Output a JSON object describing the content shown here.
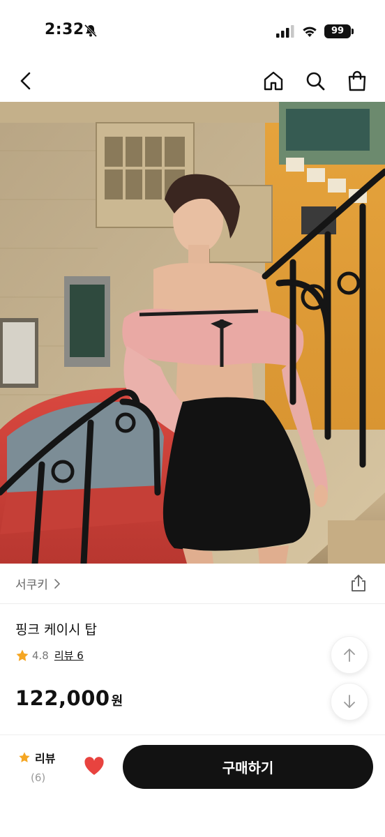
{
  "status_bar": {
    "time": "2:32",
    "battery": "99"
  },
  "nav": {
    "icons": [
      "chevron-left-icon",
      "home-icon",
      "search-icon",
      "shopping-bag-icon"
    ]
  },
  "store": {
    "name": "서쿠키"
  },
  "product": {
    "name": "핑크 케이시 탑",
    "rating": "4.8",
    "review_label": "리뷰 6",
    "price": "122,000",
    "price_unit": "원"
  },
  "bottom_bar": {
    "review_label": "리뷰",
    "review_count": "(6)",
    "buy_label": "구매하기"
  },
  "colors": {
    "star": "#f5a623",
    "heart": "#e8433f",
    "buy_button": "#121212"
  }
}
